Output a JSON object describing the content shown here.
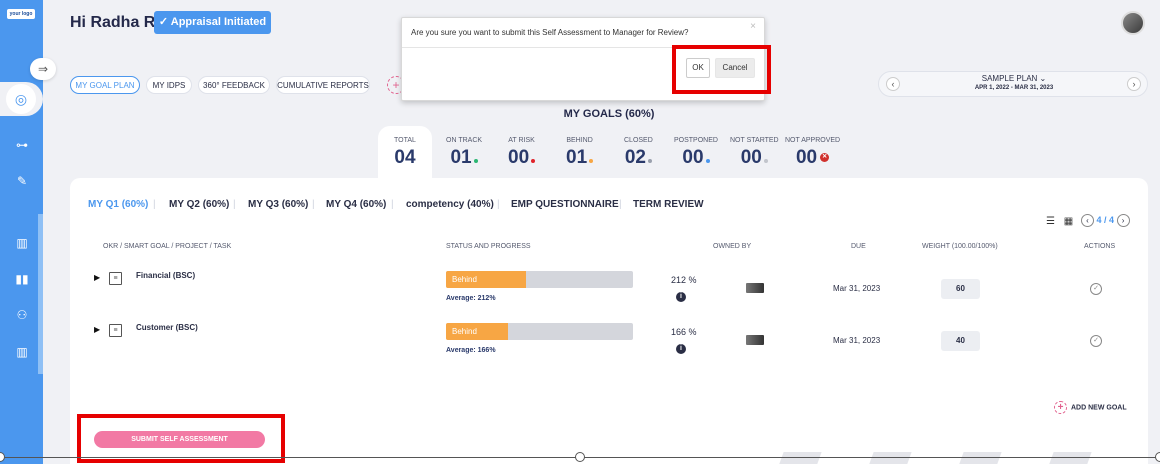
{
  "sidebar": {
    "logo": "your logo",
    "collapse_icon": "collapse-arrow-icon"
  },
  "header": {
    "greeting": "Hi Radha R",
    "appraisal_badge": "✓ Appraisal Initiated"
  },
  "tabs": [
    {
      "label": "MY GOAL PLAN"
    },
    {
      "label": "MY IDPS"
    },
    {
      "label": "360° FEEDBACK"
    },
    {
      "label": "CUMULATIVE REPORTS"
    }
  ],
  "plan": {
    "name": "SAMPLE PLAN",
    "dates": "APR 1, 2022 - MAR 31, 2023"
  },
  "goals": {
    "title": "MY GOALS (60%)",
    "stats": [
      {
        "label": "TOTAL",
        "value": "04"
      },
      {
        "label": "ON TRACK",
        "value": "01"
      },
      {
        "label": "AT RISK",
        "value": "00"
      },
      {
        "label": "BEHIND",
        "value": "01"
      },
      {
        "label": "CLOSED",
        "value": "02"
      },
      {
        "label": "POSTPONED",
        "value": "00"
      },
      {
        "label": "NOT STARTED",
        "value": "00"
      },
      {
        "label": "NOT APPROVED",
        "value": "00"
      }
    ]
  },
  "quarter_tabs": [
    {
      "label": "MY Q1 (60%)"
    },
    {
      "label": "MY Q2 (60%)"
    },
    {
      "label": "MY Q3 (60%)"
    },
    {
      "label": "MY Q4 (60%)"
    },
    {
      "label": "competency (40%)"
    },
    {
      "label": "EMP QUESTIONNAIRE"
    },
    {
      "label": "TERM REVIEW"
    }
  ],
  "pager": {
    "text": "4 / 4"
  },
  "columns": {
    "task": "OKR / SMART GOAL / PROJECT / TASK",
    "status": "STATUS AND PROGRESS",
    "owned": "OWNED BY",
    "due": "DUE",
    "weight": "WEIGHT (100.00/100%)",
    "actions": "ACTIONS"
  },
  "rows": [
    {
      "name": "Financial (BSC)",
      "status": "Behind",
      "progress": 0.43,
      "average": "Average: 212%",
      "pct": "212  %",
      "due": "Mar 31, 2023",
      "weight": "60"
    },
    {
      "name": "Customer (BSC)",
      "status": "Behind",
      "progress": 0.33,
      "average": "Average: 166%",
      "pct": "166  %",
      "due": "Mar 31, 2023",
      "weight": "40"
    }
  ],
  "add_goal": "ADD NEW GOAL",
  "submit": "SUBMIT SELF ASSESSMENT",
  "modal": {
    "message": "Are you sure you want to submit this Self Assessment to Manager for Review?",
    "ok": "OK",
    "cancel": "Cancel"
  },
  "colors": {
    "accent": "#4b97ee",
    "behind": "#f7a644",
    "submit": "#f279a4",
    "highlight": "#e60000"
  }
}
